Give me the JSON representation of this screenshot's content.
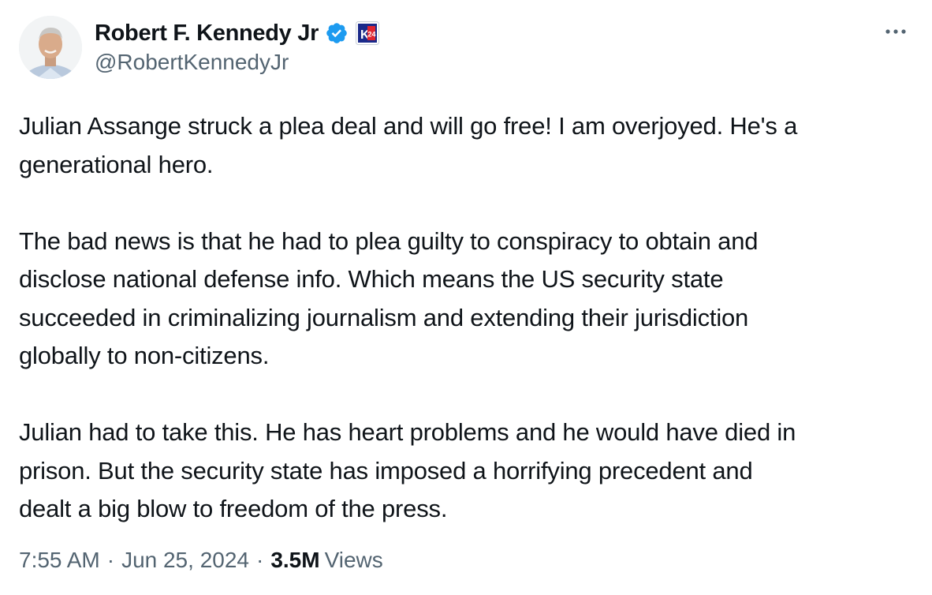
{
  "author": {
    "display_name": "Robert F. Kennedy Jr",
    "handle": "@RobertKennedyJr",
    "verified_icon": "verified-badge-icon",
    "affiliation_badge": {
      "text": "K24",
      "colors": {
        "background": "#1b2a8a",
        "accent": "#e0242f",
        "text": "#ffffff"
      }
    }
  },
  "more_button": {
    "icon": "more-horizontal-icon",
    "label": "···"
  },
  "tweet": {
    "paragraphs": [
      [
        "Julian Assange struck a plea deal and will go free! I am overjoyed. He's a",
        "generational hero."
      ],
      [
        "The bad news is that he had to plea guilty to conspiracy to obtain and",
        "disclose national defense info. Which means the US security state",
        "succeeded in criminalizing journalism and extending their jurisdiction",
        "globally to non-citizens."
      ],
      [
        "Julian had to take this. He has heart problems and he would have died in",
        "prison. But the security state has imposed a horrifying precedent and",
        "dealt a big blow to freedom of the press."
      ]
    ]
  },
  "meta": {
    "time": "7:55 AM",
    "separator": "·",
    "date": "Jun 25, 2024",
    "views_count": "3.5M",
    "views_label": "Views"
  },
  "colors": {
    "text_primary": "#0f1419",
    "text_secondary": "#536471",
    "verified_blue": "#1d9bf0",
    "background": "#ffffff"
  }
}
